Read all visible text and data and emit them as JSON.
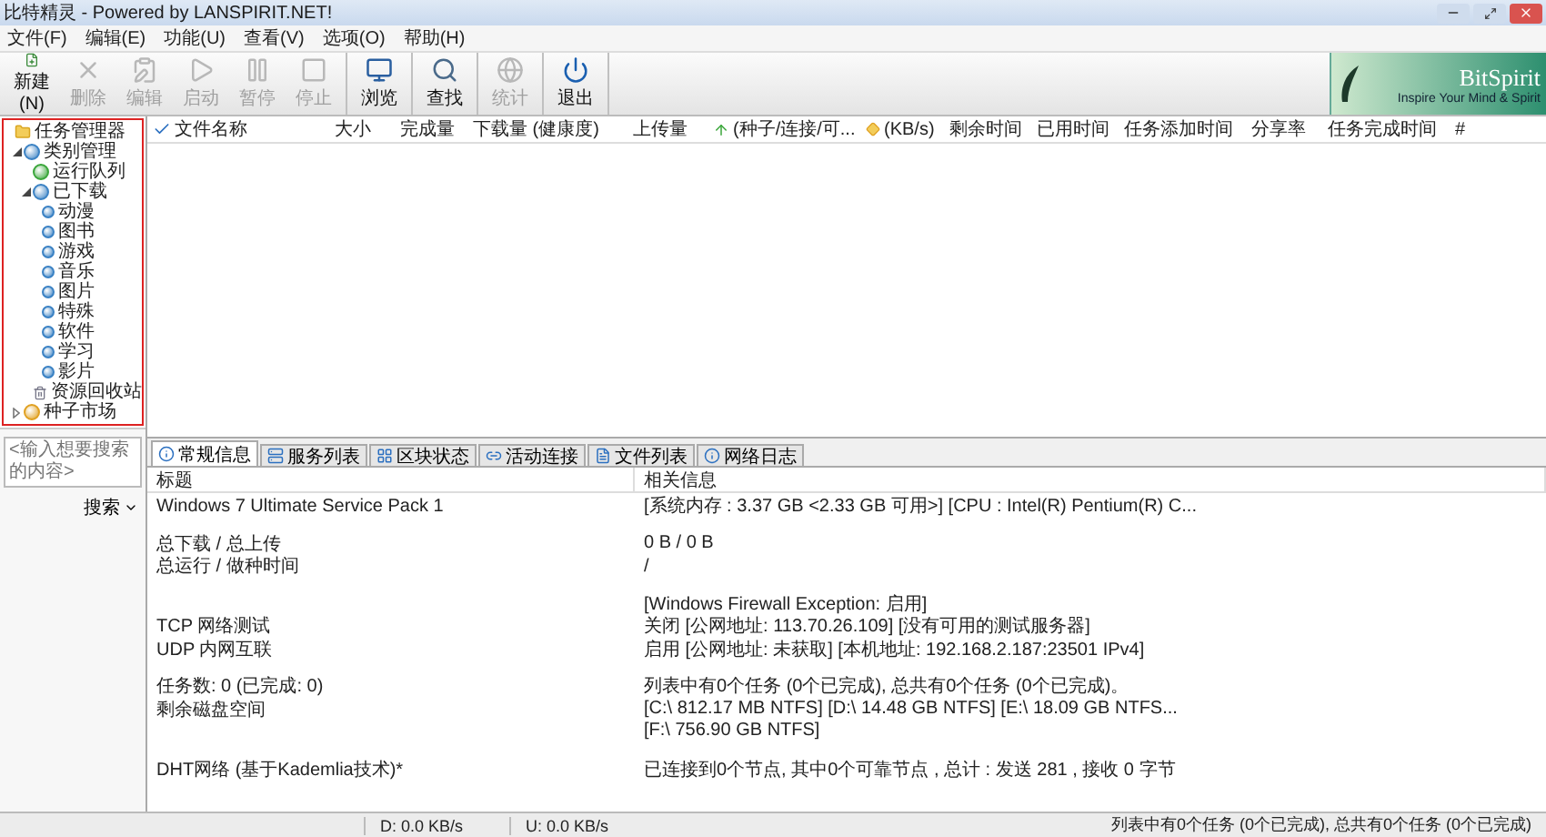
{
  "window": {
    "title": "比特精灵 - Powered by LANSPIRIT.NET!"
  },
  "menu": [
    "文件(F)",
    "编辑(E)",
    "功能(U)",
    "查看(V)",
    "选项(O)",
    "帮助(H)"
  ],
  "toolbar": [
    [
      {
        "label": "新建(N)",
        "kind": "new",
        "disabled": false
      },
      {
        "label": "删除",
        "kind": "delete",
        "disabled": true
      },
      {
        "label": "编辑",
        "kind": "edit",
        "disabled": true
      },
      {
        "label": "启动",
        "kind": "start",
        "disabled": true
      },
      {
        "label": "暂停",
        "kind": "pause",
        "disabled": true
      },
      {
        "label": "停止",
        "kind": "stop",
        "disabled": true
      }
    ],
    [
      {
        "label": "浏览",
        "kind": "browse",
        "disabled": false
      }
    ],
    [
      {
        "label": "查找",
        "kind": "find",
        "disabled": false
      }
    ],
    [
      {
        "label": "统计",
        "kind": "stats",
        "disabled": true
      }
    ],
    [
      {
        "label": "退出",
        "kind": "exit",
        "disabled": false
      }
    ]
  ],
  "logo": {
    "name": "BitSpirit",
    "slogan": "Inspire Your Mind & Spirit"
  },
  "tree": [
    {
      "label": "任务管理器",
      "kind": "root",
      "children": [
        {
          "label": "类别管理",
          "kind": "category",
          "expanded": true,
          "children": [
            {
              "label": "运行队列",
              "kind": "queue"
            },
            {
              "label": "已下载",
              "kind": "category",
              "expanded": true,
              "children": [
                {
                  "label": "动漫",
                  "kind": "tag"
                },
                {
                  "label": "图书",
                  "kind": "tag"
                },
                {
                  "label": "游戏",
                  "kind": "tag"
                },
                {
                  "label": "音乐",
                  "kind": "tag"
                },
                {
                  "label": "图片",
                  "kind": "tag"
                },
                {
                  "label": "特殊",
                  "kind": "tag"
                },
                {
                  "label": "软件",
                  "kind": "tag"
                },
                {
                  "label": "学习",
                  "kind": "tag"
                },
                {
                  "label": "影片",
                  "kind": "tag"
                }
              ]
            },
            {
              "label": "资源回收站",
              "kind": "recycle"
            }
          ]
        },
        {
          "label": "种子市场",
          "kind": "market",
          "expanded": false
        }
      ]
    }
  ],
  "search": {
    "placeholder": "<输入想要搜索的内容>",
    "button": "搜索"
  },
  "table": {
    "columns": [
      {
        "label": "文件名称",
        "kind": "check"
      },
      {
        "label": "大小",
        "kind": "plain"
      },
      {
        "label": "完成量",
        "kind": "plain"
      },
      {
        "label": "下载量 (健康度)",
        "kind": "plain"
      },
      {
        "label": "上传量",
        "kind": "plain"
      },
      {
        "label": "(种子/连接/可...",
        "kind": "seeds"
      },
      {
        "label": "(KB/s)",
        "kind": "speed"
      },
      {
        "label": "剩余时间",
        "kind": "plain"
      },
      {
        "label": "已用时间",
        "kind": "plain"
      },
      {
        "label": "任务添加时间",
        "kind": "plain"
      },
      {
        "label": "分享率",
        "kind": "plain"
      },
      {
        "label": "任务完成时间",
        "kind": "plain"
      },
      {
        "label": "#",
        "kind": "plain"
      }
    ]
  },
  "tabs": [
    {
      "label": "常规信息",
      "kind": "info",
      "selected": true
    },
    {
      "label": "服务列表",
      "kind": "server",
      "selected": false
    },
    {
      "label": "区块状态",
      "kind": "blocks",
      "selected": false
    },
    {
      "label": "活动连接",
      "kind": "links",
      "selected": false
    },
    {
      "label": "文件列表",
      "kind": "files",
      "selected": false
    },
    {
      "label": "网络日志",
      "kind": "log",
      "selected": false
    }
  ],
  "info": {
    "headers": [
      "标题",
      "相关信息"
    ],
    "groups": [
      [
        {
          "label": "Windows 7 Ultimate Service Pack 1",
          "value": "[系统内存 : 3.37 GB <2.33 GB 可用>] [CPU : Intel(R) Pentium(R) C..."
        }
      ],
      [
        {
          "label": "总下载 / 总上传",
          "value": "0 B / 0 B"
        },
        {
          "label": "总运行 / 做种时间",
          "value": "/"
        }
      ],
      [
        {
          "value": "[Windows Firewall Exception: 启用]"
        },
        {
          "label": "TCP 网络测试",
          "value": "关闭 [公网地址: 113.70.26.109] [没有可用的测试服务器]"
        },
        {
          "label": "UDP 内网互联",
          "value": "启用 [公网地址: 未获取] [本机地址: 192.168.2.187:23501 IPv4]"
        }
      ],
      [
        {
          "label": "任务数: 0 (已完成: 0)",
          "value": "列表中有0个任务 (0个已完成), 总共有0个任务 (0个已完成)。"
        },
        {
          "label": "剩余磁盘空间",
          "value": "[C:\\ 812.17 MB  NTFS]  [D:\\ 14.48 GB  NTFS]  [E:\\ 18.09 GB  NTFS..."
        },
        {
          "value": "[F:\\ 756.90 GB  NTFS]"
        }
      ],
      [
        {
          "label": "DHT网络 (基于Kademlia技术)*",
          "value": "已连接到0个节点, 其中0个可靠节点 , 总计 : 发送 281 , 接收 0 字节"
        }
      ]
    ]
  },
  "status_bar": {
    "speeds": [
      "D: 0.0 KB/s",
      "U: 0.0 KB/s"
    ],
    "summary": "列表中有0个任务 (0个已完成), 总共有0个任务 (0个已完成)"
  }
}
